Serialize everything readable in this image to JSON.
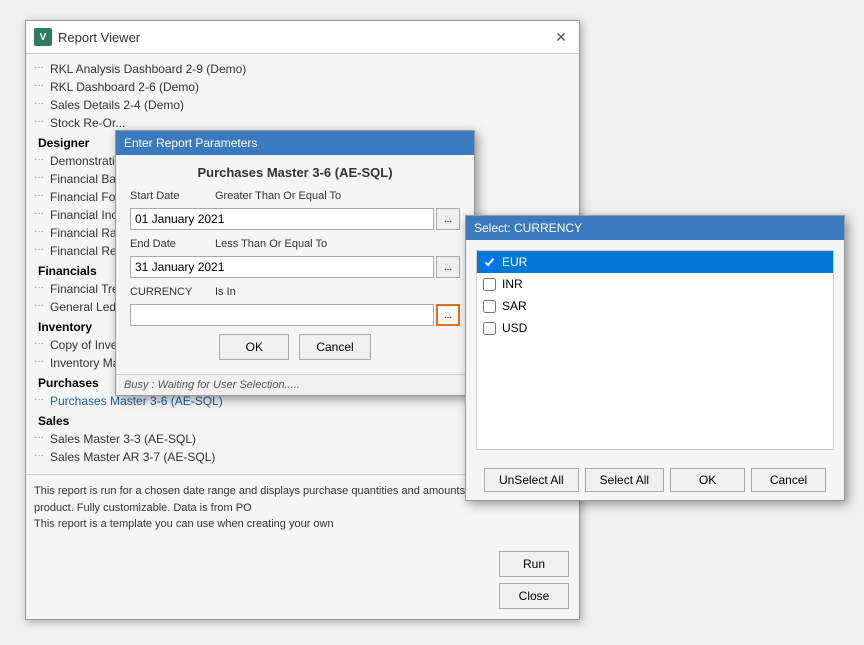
{
  "reportViewer": {
    "title": "Report Viewer",
    "appIconLabel": "V",
    "treeItems": [
      {
        "label": "RKL Analysis Dashboard 2-9 (Demo)",
        "indent": 1
      },
      {
        "label": "RKL Dashboard 2-6 (Demo)",
        "indent": 1
      },
      {
        "label": "Sales Details 2-4 (Demo)",
        "indent": 1
      },
      {
        "label": "Stock Re-Or...",
        "indent": 1
      }
    ],
    "sections": [
      {
        "header": "Designer",
        "items": [
          "Demonstratio...",
          "Financial Bal...",
          "Financial For...",
          "Financial Inc...",
          "Financial Rat...",
          "Financial Re..."
        ]
      },
      {
        "header": "Financials",
        "items": [
          "Financial Tre...",
          "General Ledg..."
        ]
      },
      {
        "header": "Inventory",
        "items": [
          "Copy of Inve...",
          "Inventory Ma..."
        ]
      },
      {
        "header": "Purchases",
        "items": [
          "Purchases Master 3-6 (AE-SQL)"
        ]
      },
      {
        "header": "Sales",
        "items": [
          "Sales Master 3-3 (AE-SQL)",
          "Sales Master AR 3-7 (AE-SQL)"
        ]
      }
    ],
    "description": "This report is run for a chosen date range and displays purchase quantities and amounts by supplier and product. Fully customizable. Data is from PO",
    "descriptionLine2": "This report is a template you can use when creating your own",
    "runButtonLabel": "Run",
    "closeButtonLabel": "Close"
  },
  "paramsDialog": {
    "titlebarText": "Enter Report Parameters",
    "reportTitle": "Purchases Master 3-6 (AE-SQL)",
    "startDateLabel": "Start Date",
    "startDateCondition": "Greater Than Or Equal To",
    "startDateValue": "01 January 2021",
    "endDateLabel": "End Date",
    "endDateCondition": "Less Than Or Equal To",
    "endDateValue": "31 January 2021",
    "currencyLabel": "CURRENCY",
    "currencyCondition": "Is In",
    "currencyValue": "",
    "browseBtnLabel": "...",
    "okLabel": "OK",
    "cancelLabel": "Cancel",
    "statusText": "Busy : Waiting for User Selection....."
  },
  "currencyDialog": {
    "titleText": "Select: CURRENCY",
    "items": [
      {
        "label": "EUR",
        "checked": true,
        "selected": true
      },
      {
        "label": "INR",
        "checked": false,
        "selected": false
      },
      {
        "label": "SAR",
        "checked": false,
        "selected": false
      },
      {
        "label": "USD",
        "checked": false,
        "selected": false
      }
    ],
    "unselectAllLabel": "UnSelect All",
    "selectAllLabel": "Select All",
    "okLabel": "OK",
    "cancelLabel": "Cancel"
  }
}
